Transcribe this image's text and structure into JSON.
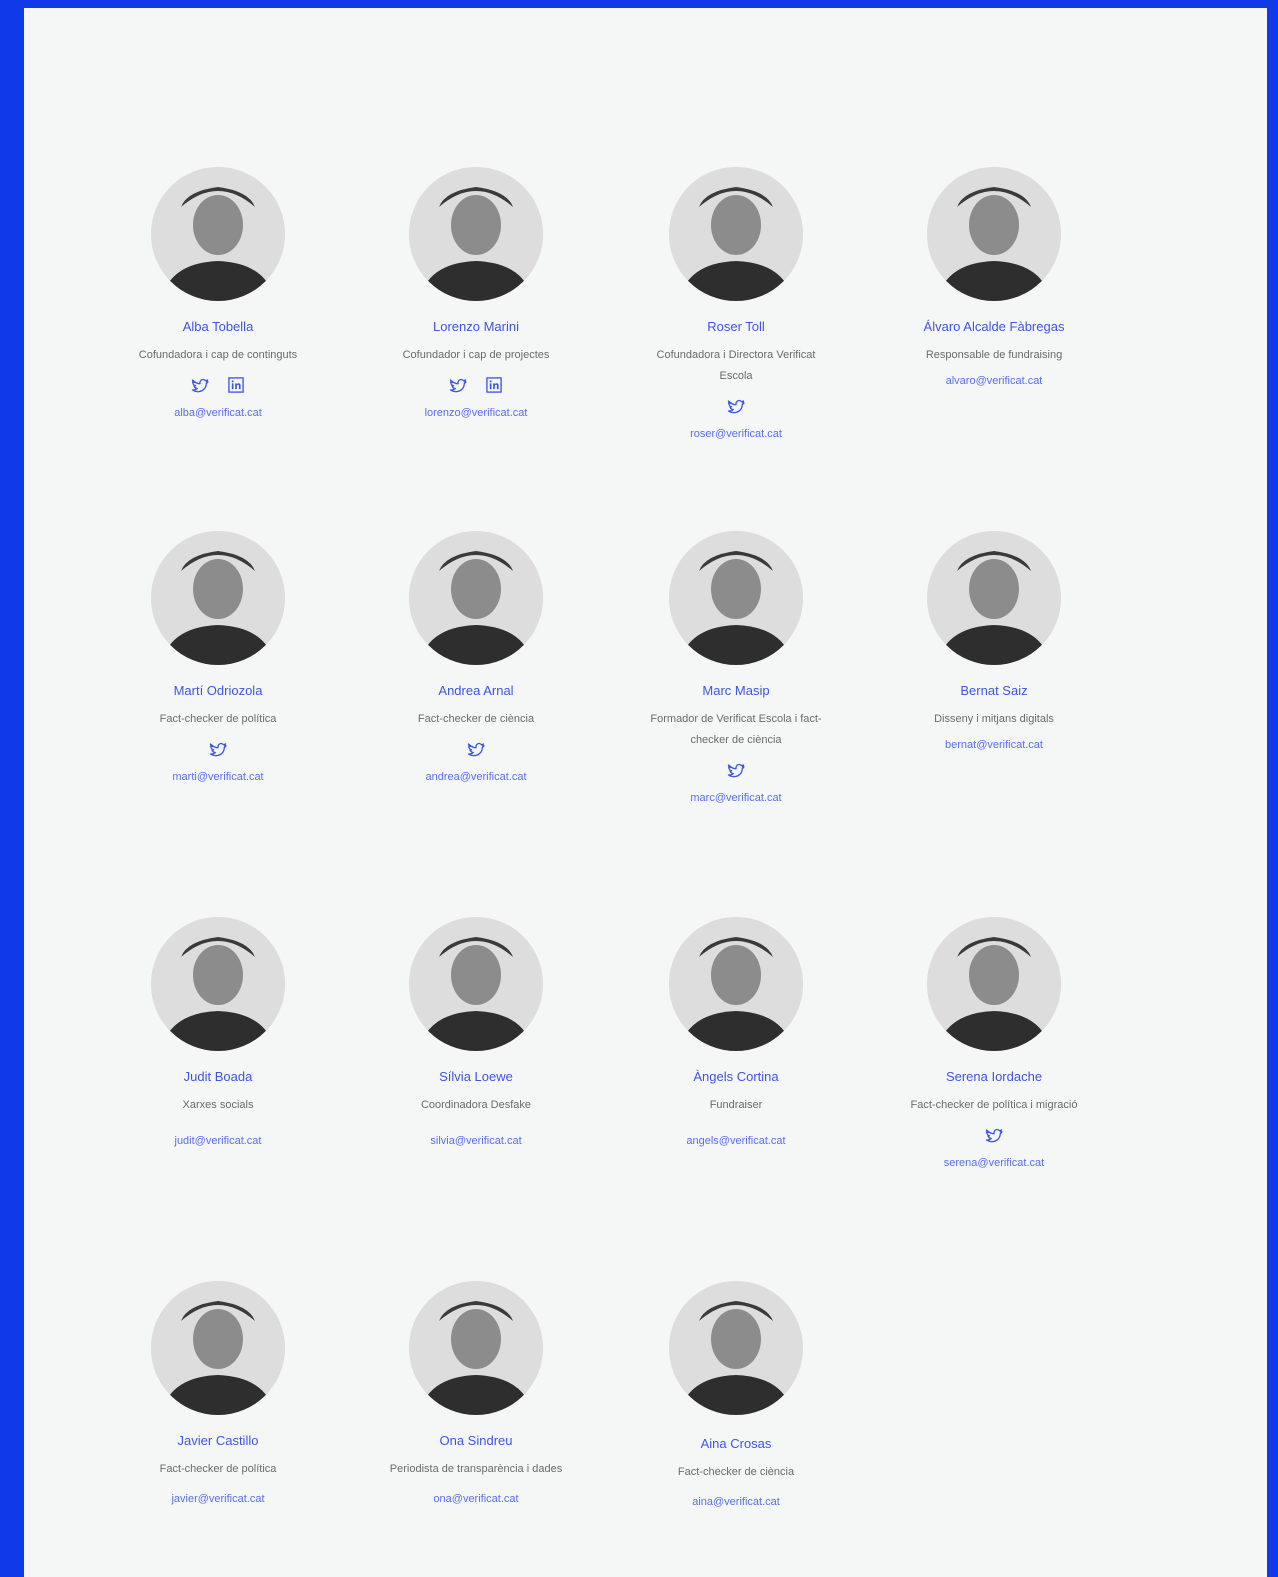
{
  "accent": "#1039e8",
  "link_color": "#3f55e6",
  "members": [
    {
      "name": "Alba Tobella",
      "role": "Cofundadora i cap de continguts",
      "socials": [
        "twitter-icon",
        "linkedin-icon"
      ],
      "email": "alba@verificat.cat"
    },
    {
      "name": "Lorenzo Marini",
      "role": "Cofundador i cap de projectes",
      "socials": [
        "twitter-icon",
        "linkedin-icon"
      ],
      "email": "lorenzo@verificat.cat"
    },
    {
      "name": "Roser Toll",
      "role": "Cofundadora i Directora Verificat Escola",
      "socials": [
        "twitter-icon"
      ],
      "email": "roser@verificat.cat"
    },
    {
      "name": "Álvaro Alcalde Fàbregas",
      "role": "Responsable de fundraising",
      "socials": [],
      "email": "alvaro@verificat.cat"
    },
    {
      "name": "Martí Odriozola",
      "role": "Fact-checker de política",
      "socials": [
        "twitter-icon"
      ],
      "email": "marti@verificat.cat"
    },
    {
      "name": "Andrea Arnal",
      "role": "Fact-checker de ciència",
      "socials": [
        "twitter-icon"
      ],
      "email": "andrea@verificat.cat"
    },
    {
      "name": "Marc Masip",
      "role": "Formador de Verificat Escola i fact-checker de ciència",
      "socials": [
        "twitter-icon"
      ],
      "email": "marc@verificat.cat"
    },
    {
      "name": "Bernat Saiz",
      "role": "Disseny i mitjans digitals",
      "socials": [],
      "email": "bernat@verificat.cat"
    },
    {
      "name": "Judit Boada",
      "role": "Xarxes socials",
      "socials": [],
      "email": "judit@verificat.cat"
    },
    {
      "name": "Sílvia Loewe",
      "role": "Coordinadora Desfake",
      "socials": [],
      "email": "silvia@verificat.cat"
    },
    {
      "name": "Àngels Cortina",
      "role": "Fundraiser",
      "socials": [],
      "email": "angels@verificat.cat"
    },
    {
      "name": "Serena Iordache",
      "role": "Fact-checker de política i migració",
      "socials": [
        "twitter-icon"
      ],
      "email": "serena@verificat.cat"
    },
    {
      "name": "Javier Castillo",
      "role": "Fact-checker de política",
      "socials": [],
      "email": "javier@verificat.cat"
    },
    {
      "name": "Ona Sindreu",
      "role": "Periodista de transparència i dades",
      "socials": [],
      "email": "ona@verificat.cat"
    },
    {
      "name": "Aina Crosas",
      "role": "Fact-checker de ciència",
      "socials": [],
      "email": "aina@verificat.cat"
    }
  ]
}
